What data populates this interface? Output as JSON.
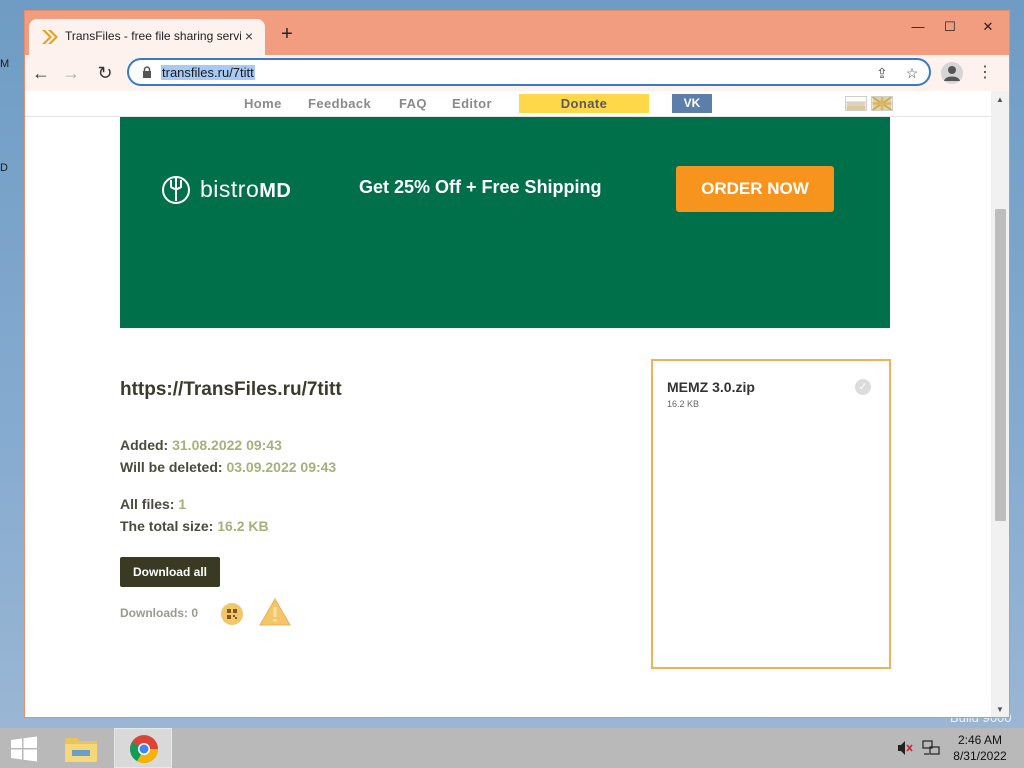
{
  "desktop": {
    "fragments": [
      "M",
      "D"
    ],
    "build_text": "Build 9600"
  },
  "browser": {
    "tab": {
      "title": "TransFiles - free file sharing servi",
      "close": "×"
    },
    "newtab": "+",
    "window_controls": {
      "minimize": "—",
      "maximize": "☐",
      "close": "✕"
    },
    "nav": {
      "back": "←",
      "forward": "→",
      "reload": "↻"
    },
    "url": "transfiles.ru/7titt",
    "menu": "⋮"
  },
  "site_nav": {
    "items": [
      "Home",
      "Feedback",
      "FAQ",
      "Editor"
    ],
    "donate": "Donate",
    "vk": "VK"
  },
  "ad": {
    "brand_light": "bistro",
    "brand_bold": "MD",
    "tagline": "Get 25% Off + Free Shipping",
    "cta": "ORDER NOW",
    "bg_color": "#00704a",
    "cta_color": "#f7941d"
  },
  "share": {
    "link": "https://TransFiles.ru/7titt",
    "added_label": "Added:",
    "added_value": "31.08.2022 09:43",
    "deleted_label": "Will be deleted:",
    "deleted_value": "03.09.2022 09:43",
    "files_label": "All files:",
    "files_value": "1",
    "size_label": "The total size:",
    "size_value": "16.2 KB",
    "download_button": "Download all",
    "downloads_label": "Downloads: 0"
  },
  "files": [
    {
      "name": "MEMZ 3.0.zip",
      "size": "16.2 KB"
    }
  ],
  "taskbar": {
    "time": "2:46 AM",
    "date": "8/31/2022"
  }
}
